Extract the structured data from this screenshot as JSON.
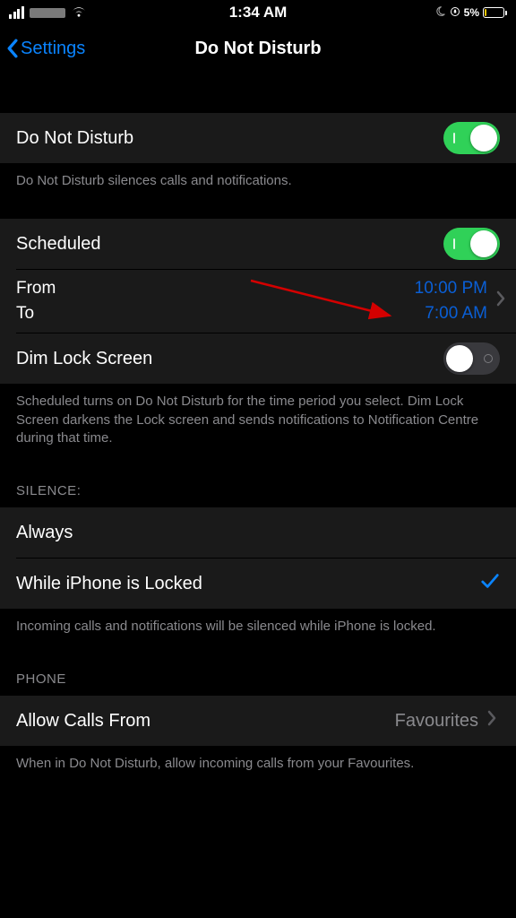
{
  "status_bar": {
    "time": "1:34 AM",
    "battery_percent": "5%"
  },
  "nav": {
    "back_label": "Settings",
    "title": "Do Not Disturb"
  },
  "sections": {
    "dnd": {
      "label": "Do Not Disturb",
      "footer": "Do Not Disturb silences calls and notifications."
    },
    "scheduled": {
      "label": "Scheduled",
      "from_label": "From",
      "to_label": "To",
      "from_value": "10:00 PM",
      "to_value": "7:00 AM",
      "dim_label": "Dim Lock Screen",
      "footer": "Scheduled turns on Do Not Disturb for the time period you select. Dim Lock Screen darkens the Lock screen and sends notifications to Notification Centre during that time."
    },
    "silence": {
      "header": "SILENCE:",
      "always": "Always",
      "while_locked": "While iPhone is Locked",
      "footer": "Incoming calls and notifications will be silenced while iPhone is locked."
    },
    "phone": {
      "header": "PHONE",
      "allow_calls_label": "Allow Calls From",
      "allow_calls_value": "Favourites",
      "footer": "When in Do Not Disturb, allow incoming calls from your Favourites."
    }
  }
}
